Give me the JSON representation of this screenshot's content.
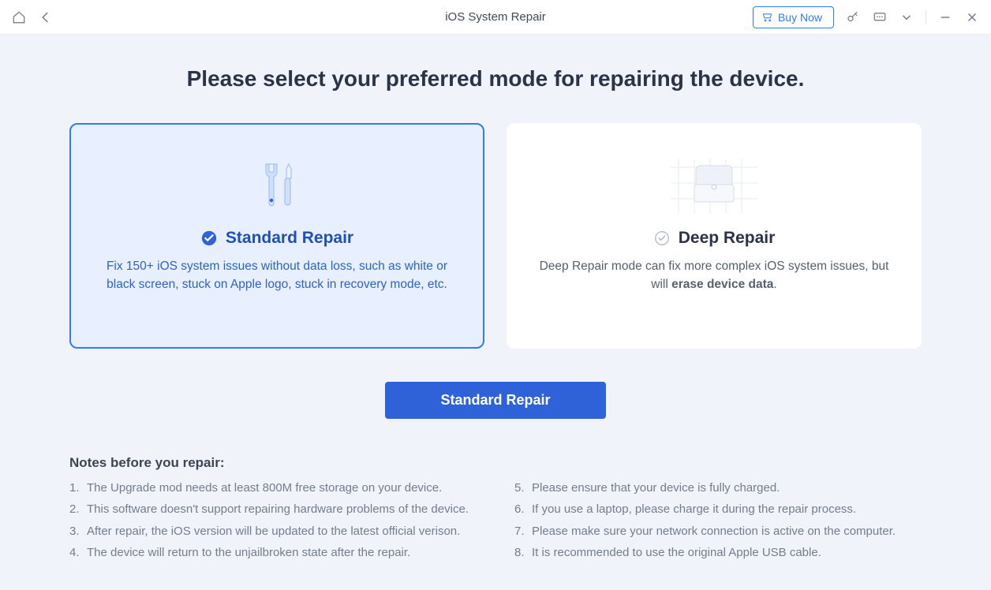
{
  "titlebar": {
    "title": "iOS System Repair",
    "buy_label": "Buy Now"
  },
  "headline": "Please select your preferred mode for repairing the device.",
  "modes": {
    "standard": {
      "title": "Standard Repair",
      "desc": "Fix 150+ iOS system issues without data loss, such as white or black screen, stuck on Apple logo, stuck in recovery mode, etc."
    },
    "deep": {
      "title": "Deep Repair",
      "desc_pre": "Deep Repair mode can fix more complex iOS system issues, but will ",
      "desc_strong": "erase device data",
      "desc_post": "."
    }
  },
  "action_label": "Standard Repair",
  "notes": {
    "title": "Notes before you repair:",
    "left": [
      "The Upgrade mod needs at least 800M free storage on your device.",
      "This software doesn't support repairing hardware problems of the device.",
      "After repair, the iOS version will be updated to the latest official verison.",
      "The device will return to the unjailbroken state after the repair."
    ],
    "right": [
      "Please ensure that your device is fully charged.",
      "If you use a laptop, please charge it during the repair process.",
      "Please make sure your network connection is active on the computer.",
      "It is recommended to use the original Apple USB cable."
    ]
  }
}
